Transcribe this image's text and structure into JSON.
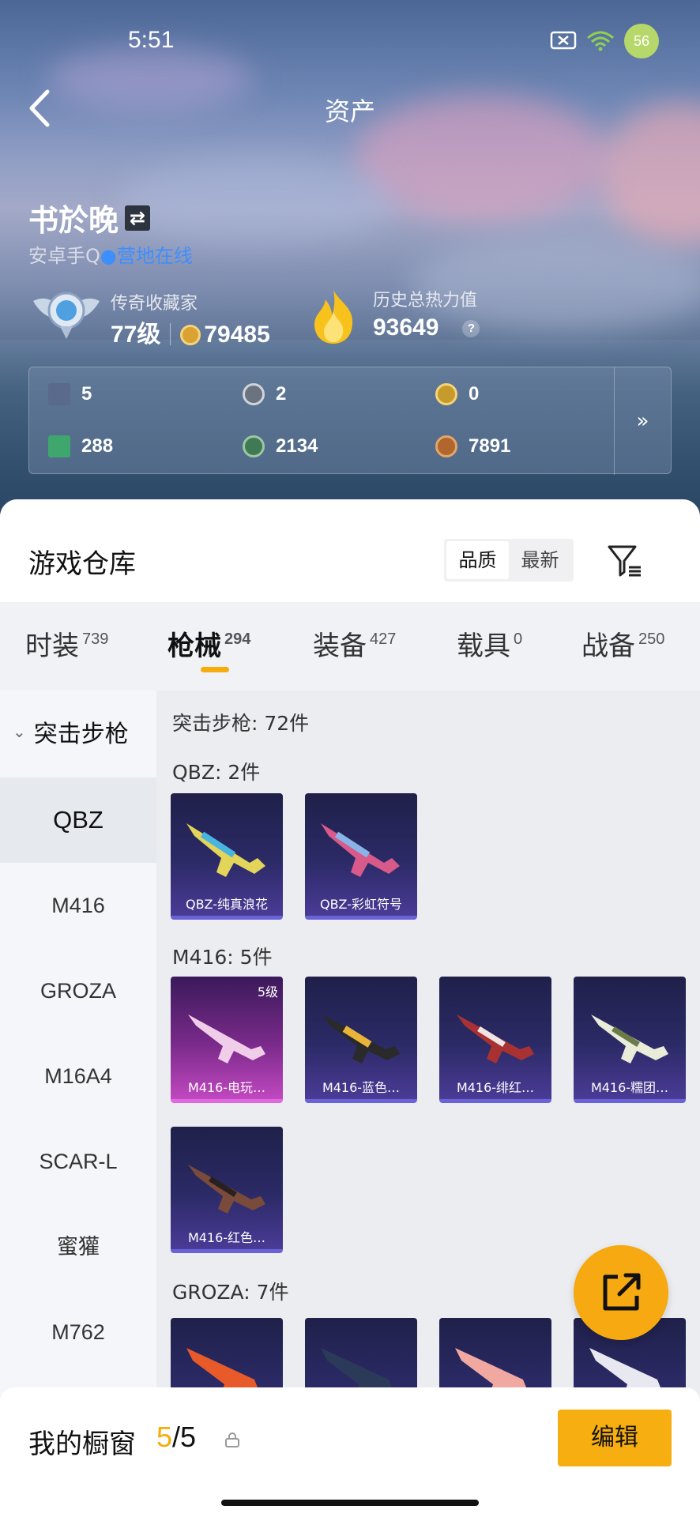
{
  "status": {
    "time": "5:51",
    "battery": "56"
  },
  "header": {
    "title": "资产"
  },
  "profile": {
    "name": "书於晚",
    "platform": "安卓手Q",
    "online": "营地在线",
    "rank_label": "传奇收藏家",
    "level": "77级",
    "coins": "79485",
    "heat_label": "历史总热力值",
    "heat": "93649",
    "help": "?"
  },
  "assets": [
    {
      "icon": "card-icon",
      "value": "5",
      "color": "#5a6a8c"
    },
    {
      "icon": "ring-token-icon",
      "value": "2",
      "color": "#6b7380"
    },
    {
      "icon": "gold-token-icon",
      "value": "0",
      "color": "#c79a2c"
    },
    {
      "icon": "green-ticket-icon",
      "value": "288",
      "color": "#3fa66e"
    },
    {
      "icon": "green-orb-icon",
      "value": "2134",
      "color": "#3f7a55"
    },
    {
      "icon": "bronze-coin-icon",
      "value": "7891",
      "color": "#b0662c"
    }
  ],
  "assets_more": "»",
  "warehouse": {
    "title": "游戏仓库",
    "sort": [
      "品质",
      "最新"
    ]
  },
  "tabs": [
    {
      "label": "时装",
      "count": "739"
    },
    {
      "label": "枪械",
      "count": "294"
    },
    {
      "label": "装备",
      "count": "427"
    },
    {
      "label": "载具",
      "count": "0"
    },
    {
      "label": "战备",
      "count": "250"
    }
  ],
  "side": {
    "category": "突击步枪",
    "items": [
      "QBZ",
      "M416",
      "GROZA",
      "M16A4",
      "SCAR-L",
      "蜜獾",
      "M762"
    ]
  },
  "content": {
    "total": "突击步枪: 72件",
    "groups": [
      {
        "title": "QBZ: 2件",
        "cards": [
          "QBZ-纯真浪花",
          "QBZ-彩虹符号"
        ]
      },
      {
        "title": "M416: 5件",
        "cards": [
          "M416-电玩…",
          "M416-蓝色…",
          "M416-绯红…",
          "M416-糯团…",
          "M416-红色…"
        ],
        "first_level": "5级"
      },
      {
        "title": "GROZA: 7件"
      }
    ]
  },
  "bottom": {
    "label": "我的橱窗",
    "count_current": "5",
    "count_sep": "/5",
    "edit": "编辑"
  }
}
